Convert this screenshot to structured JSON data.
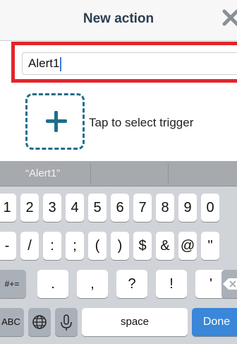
{
  "header": {
    "title": "New action",
    "close_icon": "close-icon"
  },
  "input": {
    "value": "Alert1"
  },
  "trigger": {
    "label": "Tap to select trigger",
    "icon": "plus-icon"
  },
  "suggestions": {
    "items": [
      "“Alert1”",
      "",
      ""
    ]
  },
  "keyboard": {
    "row1": [
      "1",
      "2",
      "3",
      "4",
      "5",
      "6",
      "7",
      "8",
      "9",
      "0"
    ],
    "row2": [
      "-",
      "/",
      ":",
      ";",
      "(",
      ")",
      "$",
      "&",
      "@",
      "\""
    ],
    "row3": {
      "toggle": "#+=",
      "keys": [
        ".",
        ",",
        "?",
        "!",
        "'"
      ],
      "backspace_icon": "backspace-icon"
    },
    "row4": {
      "abc": "ABC",
      "globe_icon": "globe-icon",
      "mic_icon": "microphone-icon",
      "space": "space",
      "done": "Done"
    }
  },
  "colors": {
    "highlight": "#e3242b",
    "accent": "#1f6e8c",
    "done": "#3a86d8"
  }
}
